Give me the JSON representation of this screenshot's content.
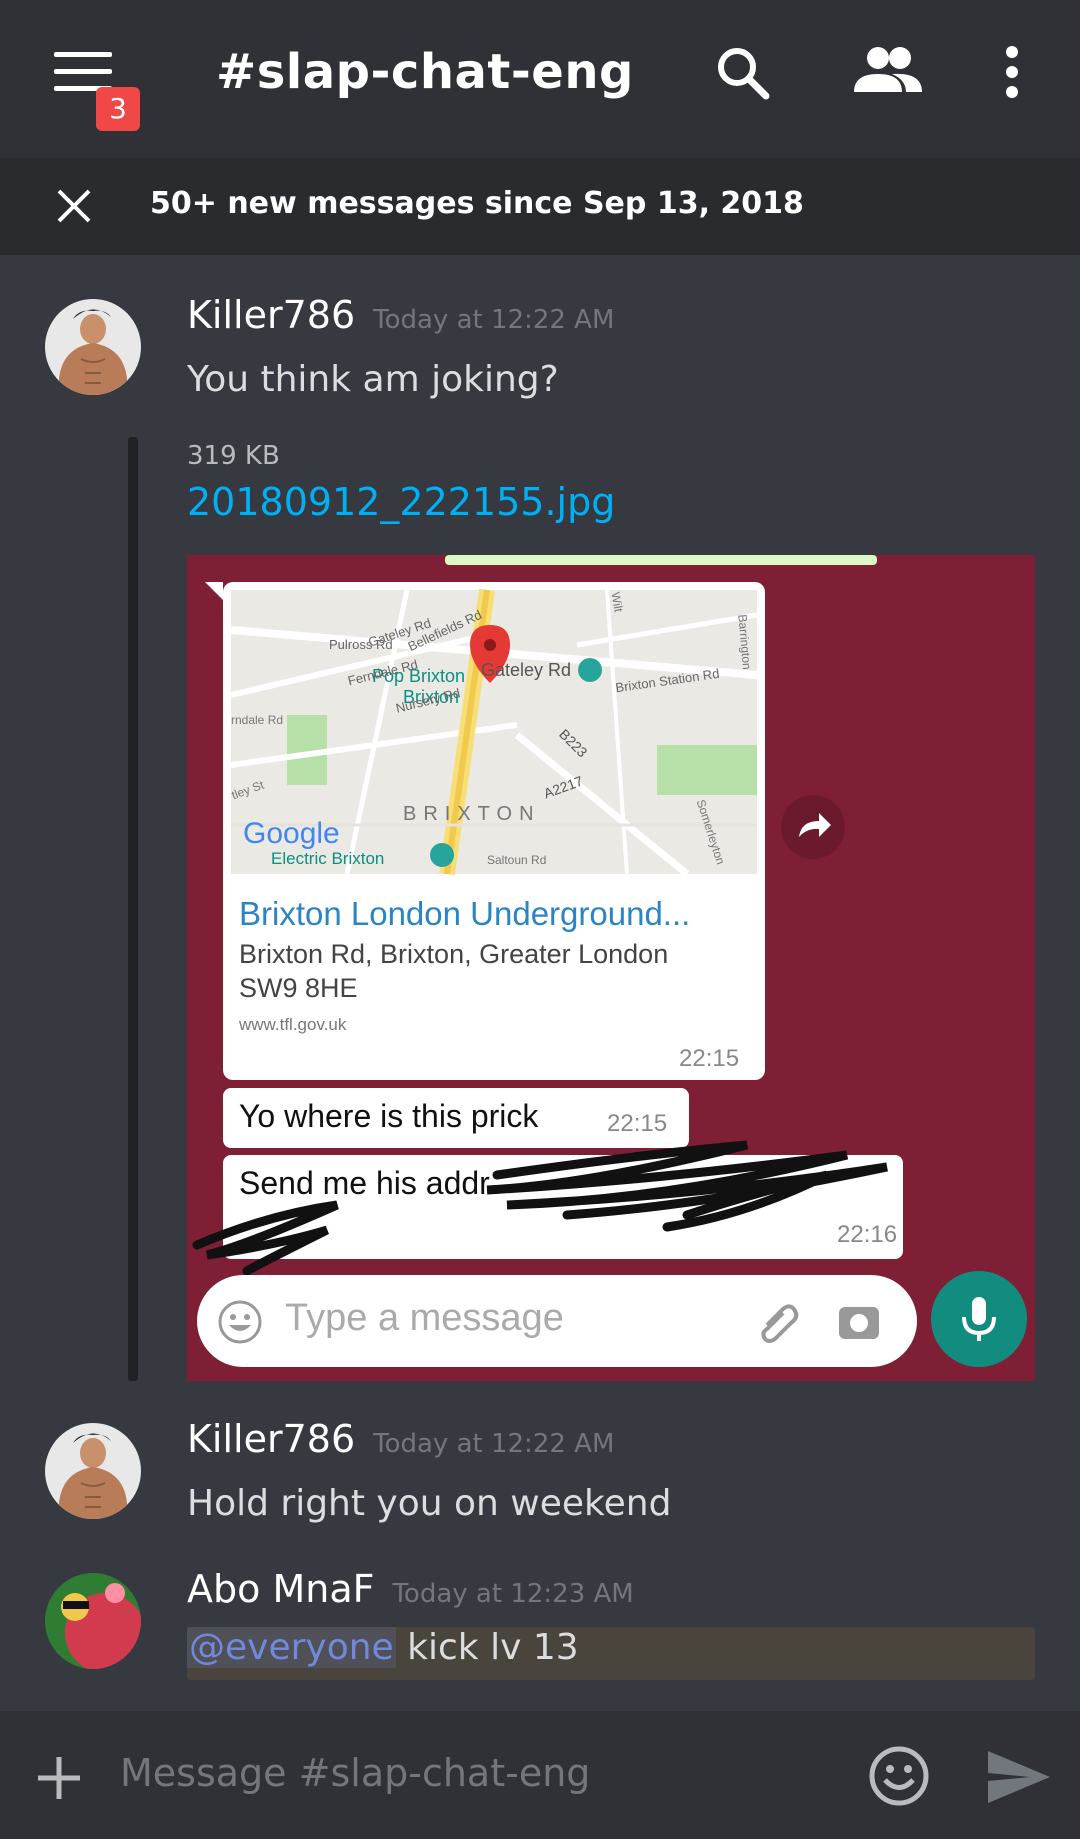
{
  "header": {
    "channel": "#slap-chat-eng",
    "notification_count": "3"
  },
  "new_messages_bar": {
    "text": "50+ new messages since Sep 13, 2018"
  },
  "messages": [
    {
      "author": "Killer786",
      "timestamp": "Today at 12:22 AM",
      "text": "You think am joking?",
      "attachment": {
        "size": "319 KB",
        "filename": "20180912_222155.jpg",
        "whatsapp": {
          "map_labels": [
            "Gateley Rd",
            "Pulross Rd",
            "Bellefields Rd",
            "Ferndale Rd",
            "Nursery Rd",
            "Pop Brixton",
            "Brixton",
            "Brixton Station Rd",
            "B223",
            "A2217",
            "BRIXTON",
            "Electric Brixton",
            "Saltoun Rd",
            "Somerleyton",
            "Barrington",
            "rndale Rd",
            "tley St",
            "Wilt"
          ],
          "map_brand": "Google",
          "link_title": "Brixton London Underground...",
          "link_address": "Brixton Rd, Brixton, Greater London SW9 8HE",
          "link_domain": "www.tfl.gov.uk",
          "link_time": "22:15",
          "bubble1_text": "Yo where is this prick",
          "bubble1_time": "22:15",
          "bubble2_text": "Send me his addr",
          "bubble2_time": "22:16",
          "input_placeholder": "Type a message"
        }
      }
    },
    {
      "author": "Killer786",
      "timestamp": "Today at 12:22 AM",
      "text": "Hold right you on weekend"
    },
    {
      "author": "Abo MnaF",
      "timestamp": "Today at 12:23 AM",
      "mention": "@everyone",
      "text": " kick lv 13"
    }
  ],
  "composer": {
    "placeholder": "Message #slap-chat-eng"
  },
  "colors": {
    "background": "#36393f",
    "header": "#2f3136",
    "link": "#00b0f4",
    "mention": "#7289da",
    "badge": "#f04747",
    "whatsapp_bg": "#7e1f36",
    "whatsapp_green": "#128c7e"
  }
}
